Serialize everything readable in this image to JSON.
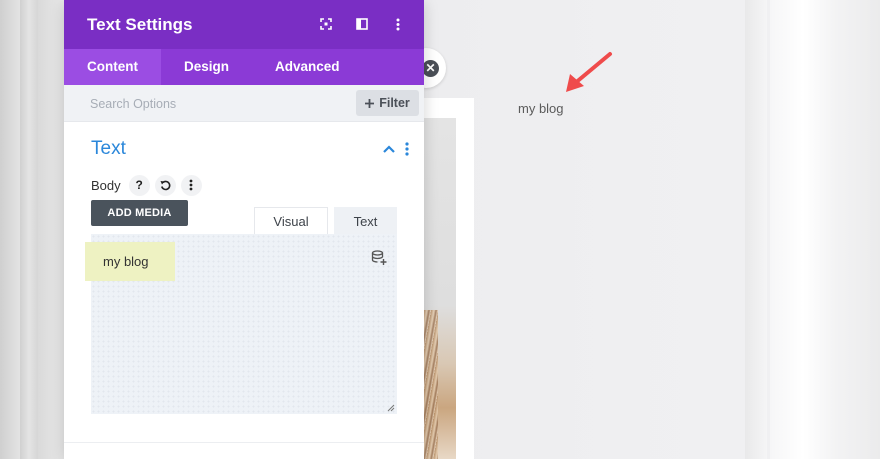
{
  "modal": {
    "title": "Text Settings",
    "tabs": [
      {
        "label": "Content",
        "active": true
      },
      {
        "label": "Design",
        "active": false
      },
      {
        "label": "Advanced",
        "active": false
      }
    ],
    "search": {
      "placeholder": "Search Options"
    },
    "filter_label": "Filter",
    "section_title": "Text",
    "field_label": "Body",
    "help_glyph": "?",
    "add_media_label": "ADD MEDIA",
    "editor_tabs": {
      "visual": "Visual",
      "text": "Text"
    },
    "editor_content": "my blog"
  },
  "preview": {
    "text": "my blog"
  },
  "colors": {
    "header": "#7a2ec4",
    "tabs": "#8b3ad6",
    "active_tab": "#9b4de3",
    "section_title": "#2b87da",
    "arrow": "#ef4b4b",
    "add_media": "#4a535c"
  },
  "icons": [
    "expand-icon",
    "sidebar-layout-icon",
    "more-vertical-icon",
    "plus-icon",
    "chevron-up-icon",
    "question-icon",
    "undo-icon",
    "database-add-icon",
    "resize-handle-icon",
    "close-icon",
    "arrow-icon"
  ]
}
